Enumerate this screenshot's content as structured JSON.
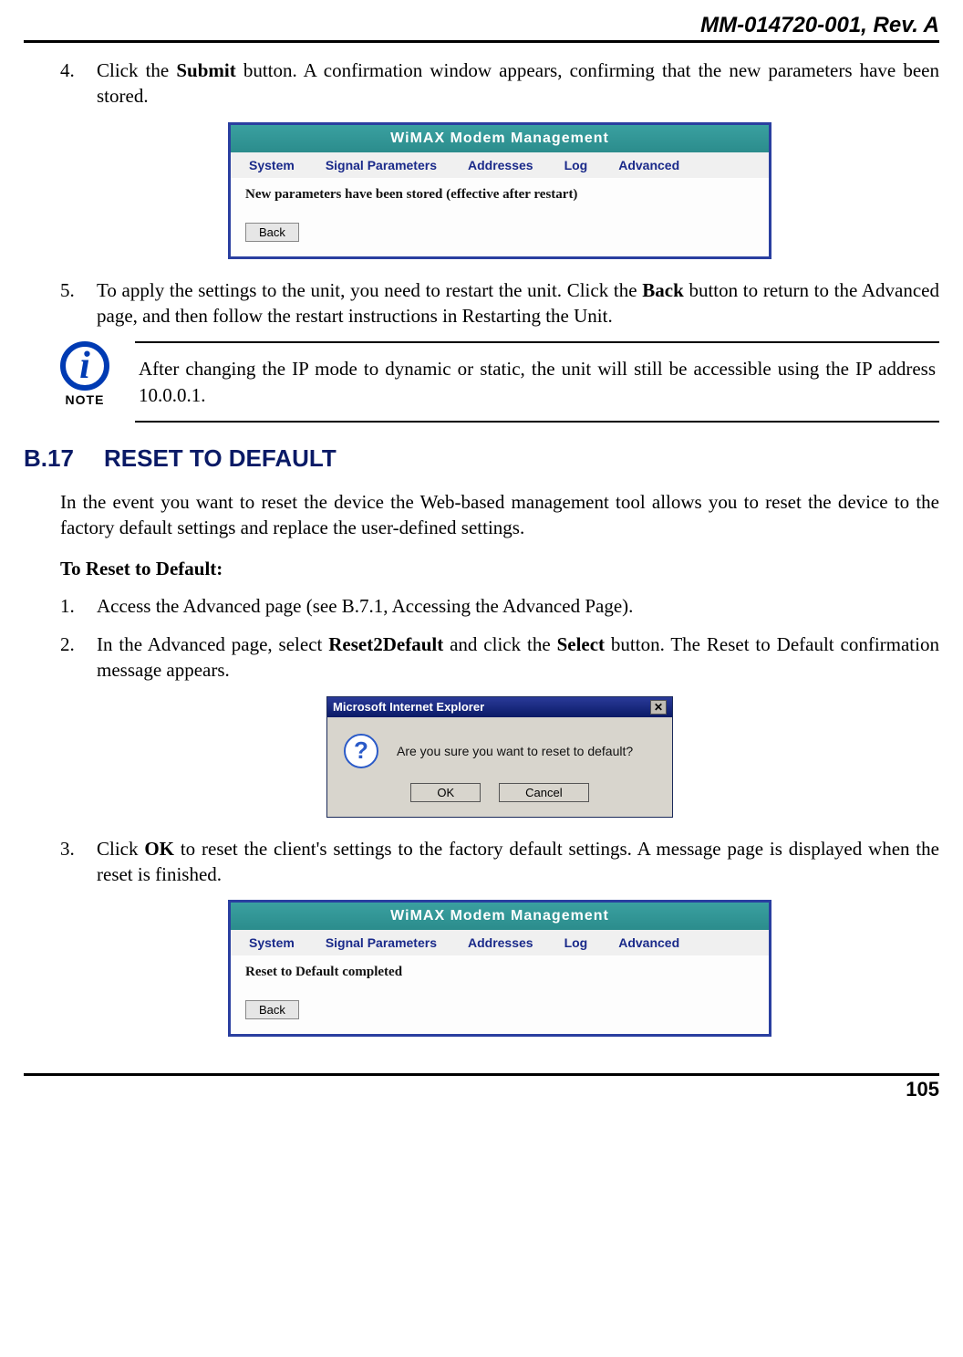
{
  "header": "MM-014720-001, Rev. A",
  "page_number": "105",
  "steps_a": {
    "s4_num": "4.",
    "s4_a": "Click the ",
    "s4_b": "Submit",
    "s4_c": " button.  A confirmation window appears, confirming that the new parameters have been stored.",
    "s5_num": "5.",
    "s5_a": "To apply the settings to the unit, you need to restart the unit.  Click the ",
    "s5_b": "Back",
    "s5_c": " button to return to the Advanced page, and then follow the restart instructions in Restarting the Unit."
  },
  "modem": {
    "title": "WiMAX Modem Management",
    "nav": [
      "System",
      "Signal Parameters",
      "Addresses",
      "Log",
      "Advanced"
    ],
    "msg1": "New parameters have been stored (effective after restart)",
    "msg2": "Reset to Default completed",
    "back": "Back"
  },
  "note": {
    "label": "NOTE",
    "text": "After changing the IP mode to dynamic or static, the unit will still be accessible using the IP address 10.0.0.1."
  },
  "section": {
    "num": "B.17",
    "title": "RESET TO DEFAULT"
  },
  "body": {
    "intro": "In the event you want to reset the device the Web-based management tool allows you to reset the device to the factory default settings and replace the user-defined settings.",
    "subhead": "To Reset to Default:"
  },
  "steps_b": {
    "s1_num": "1.",
    "s1": "Access the Advanced page (see B.7.1, Accessing the Advanced Page).",
    "s2_num": "2.",
    "s2_a": "In the Advanced page, select ",
    "s2_b": "Reset2Default",
    "s2_c": " and click the ",
    "s2_d": "Select",
    "s2_e": " button.   The Reset to Default confirmation message appears.",
    "s3_num": "3.",
    "s3_a": "Click ",
    "s3_b": "OK",
    "s3_c": " to reset the client's settings to the factory default settings.  A message page is displayed when the reset is finished."
  },
  "dialog": {
    "title": "Microsoft Internet Explorer",
    "msg": "Are you sure you want to reset to default?",
    "ok": "OK",
    "cancel": "Cancel"
  }
}
